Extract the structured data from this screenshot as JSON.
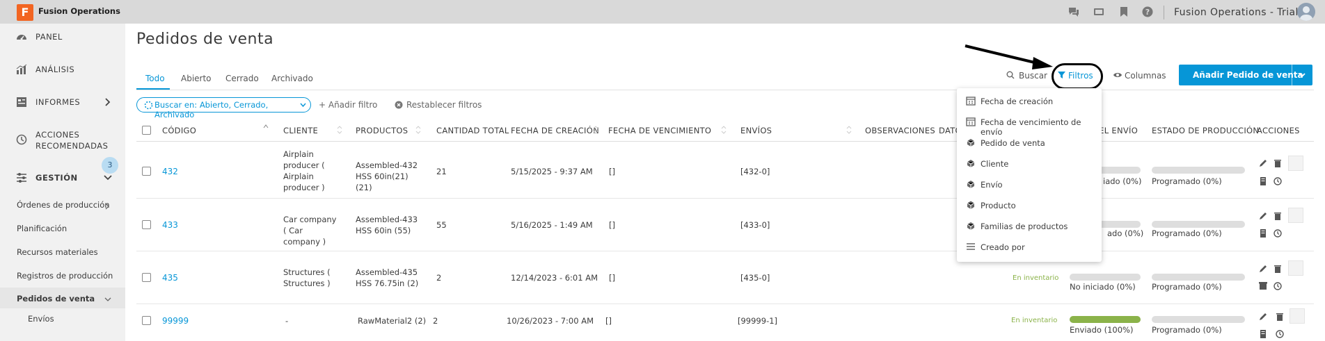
{
  "topbar": {
    "logo_letter": "F",
    "app_name": "Fusion Operations",
    "account_name": "Fusion Operations - Trial",
    "icons": [
      "chat-icon",
      "display-icon",
      "bookmark-icon",
      "help-icon"
    ]
  },
  "sidebar": {
    "items": [
      {
        "label": "PANEL",
        "icon": "dashboard-icon"
      },
      {
        "label": "ANÁLISIS",
        "icon": "chart-icon"
      },
      {
        "label": "INFORMES",
        "icon": "reports-icon"
      },
      {
        "label": "ACCIONES RECOMENDADAS",
        "line1": "ACCIONES",
        "line2": "RECOMENDADAS",
        "icon": "history-icon",
        "badge": "3"
      },
      {
        "label": "GESTIÓN",
        "icon": "sliders-icon"
      }
    ],
    "subitems": [
      "Órdenes de producción",
      "Planificación",
      "Recursos materiales",
      "Registros de producción",
      "Pedidos de venta"
    ],
    "subsub": "Envíos"
  },
  "main": {
    "title": "Pedidos de venta",
    "tabs": [
      "Todo",
      "Abierto",
      "Cerrado",
      "Archivado"
    ],
    "search_label": "Buscar",
    "filters_label": "Filtros",
    "columns_label": "Columnas",
    "add_button_label": "Añadir Pedido de venta",
    "filter_chip": "Buscar en: Abierto, Cerrado, Archivado",
    "add_filter": "+ Añadir filtro",
    "reset_filters": "Restablecer filtros"
  },
  "table": {
    "headers": {
      "code": "CÓDIGO",
      "customer": "CLIENTE",
      "products": "PRODUCTOS",
      "total_qty": "CANTIDAD TOTAL",
      "created": "FECHA DE CREACIÓN",
      "due": "FECHA DE VENCIMIENTO",
      "shipments": "ENVÍOS",
      "notes": "OBSERVACIONES",
      "data": "DATO",
      "shipping_status": "DEL ENVÍO",
      "production_status": "ESTADO DE PRODUCCIÓN",
      "actions": "ACCIONES"
    },
    "rows": [
      {
        "code": "432",
        "customer": "Airplain producer ( Airplain producer )",
        "products": "Assembled-432 HSS 60in(21) (21)",
        "qty": "21",
        "created": "5/15/2025 - 9:37 AM",
        "due": "[]",
        "shipments": "[432-0]",
        "inventory": "",
        "ship_status": "iado (0%)",
        "ship_progress": 0,
        "prod_status": "Programado (0%)",
        "prod_progress": 0
      },
      {
        "code": "433",
        "customer": "Car company ( Car company )",
        "products": "Assembled-433 HSS 60in (55)",
        "qty": "55",
        "created": "5/16/2025 - 1:49 AM",
        "due": "[]",
        "shipments": "[433-0]",
        "inventory": "",
        "ship_status": "ado (0%)",
        "ship_progress": 0,
        "prod_status": "Programado (0%)",
        "prod_progress": 0
      },
      {
        "code": "435",
        "customer": "Structures ( Structures )",
        "products": "Assembled-435 HSS 76.75in (2)",
        "qty": "2",
        "created": "12/14/2023 - 6:01 AM",
        "due": "[]",
        "shipments": "[435-0]",
        "inventory": "En inventario",
        "ship_status": "No iniciado (0%)",
        "ship_progress": 0,
        "prod_status": "Programado (0%)",
        "prod_progress": 0
      },
      {
        "code": "99999",
        "customer": "-",
        "products": "RawMaterial2 (2)",
        "qty": "2",
        "created": "10/26/2023 - 7:00 AM",
        "due": "[]",
        "shipments": "[99999-1]",
        "inventory": "En inventario",
        "ship_status": "Enviado (100%)",
        "ship_progress": 100,
        "prod_status": "Programado (0%)",
        "prod_progress": 0
      }
    ]
  },
  "filter_menu": {
    "items": [
      {
        "label": "Fecha de creación",
        "icon": "calendar-icon"
      },
      {
        "label": "Fecha de vencimiento de envío",
        "icon": "calendar-icon"
      },
      {
        "label": "Pedido de venta",
        "icon": "cubes-icon"
      },
      {
        "label": "Cliente",
        "icon": "cubes-icon"
      },
      {
        "label": "Envío",
        "icon": "cubes-icon"
      },
      {
        "label": "Producto",
        "icon": "cube-icon"
      },
      {
        "label": "Familias de productos",
        "icon": "cubes-icon"
      },
      {
        "label": "Creado por",
        "icon": "list-icon"
      }
    ]
  },
  "colors": {
    "accent": "#0696d7",
    "logo": "#f26522",
    "success": "#8bb34a",
    "sidebar_bg": "#f1f1f1",
    "topbar_bg": "#d9d9d9"
  }
}
